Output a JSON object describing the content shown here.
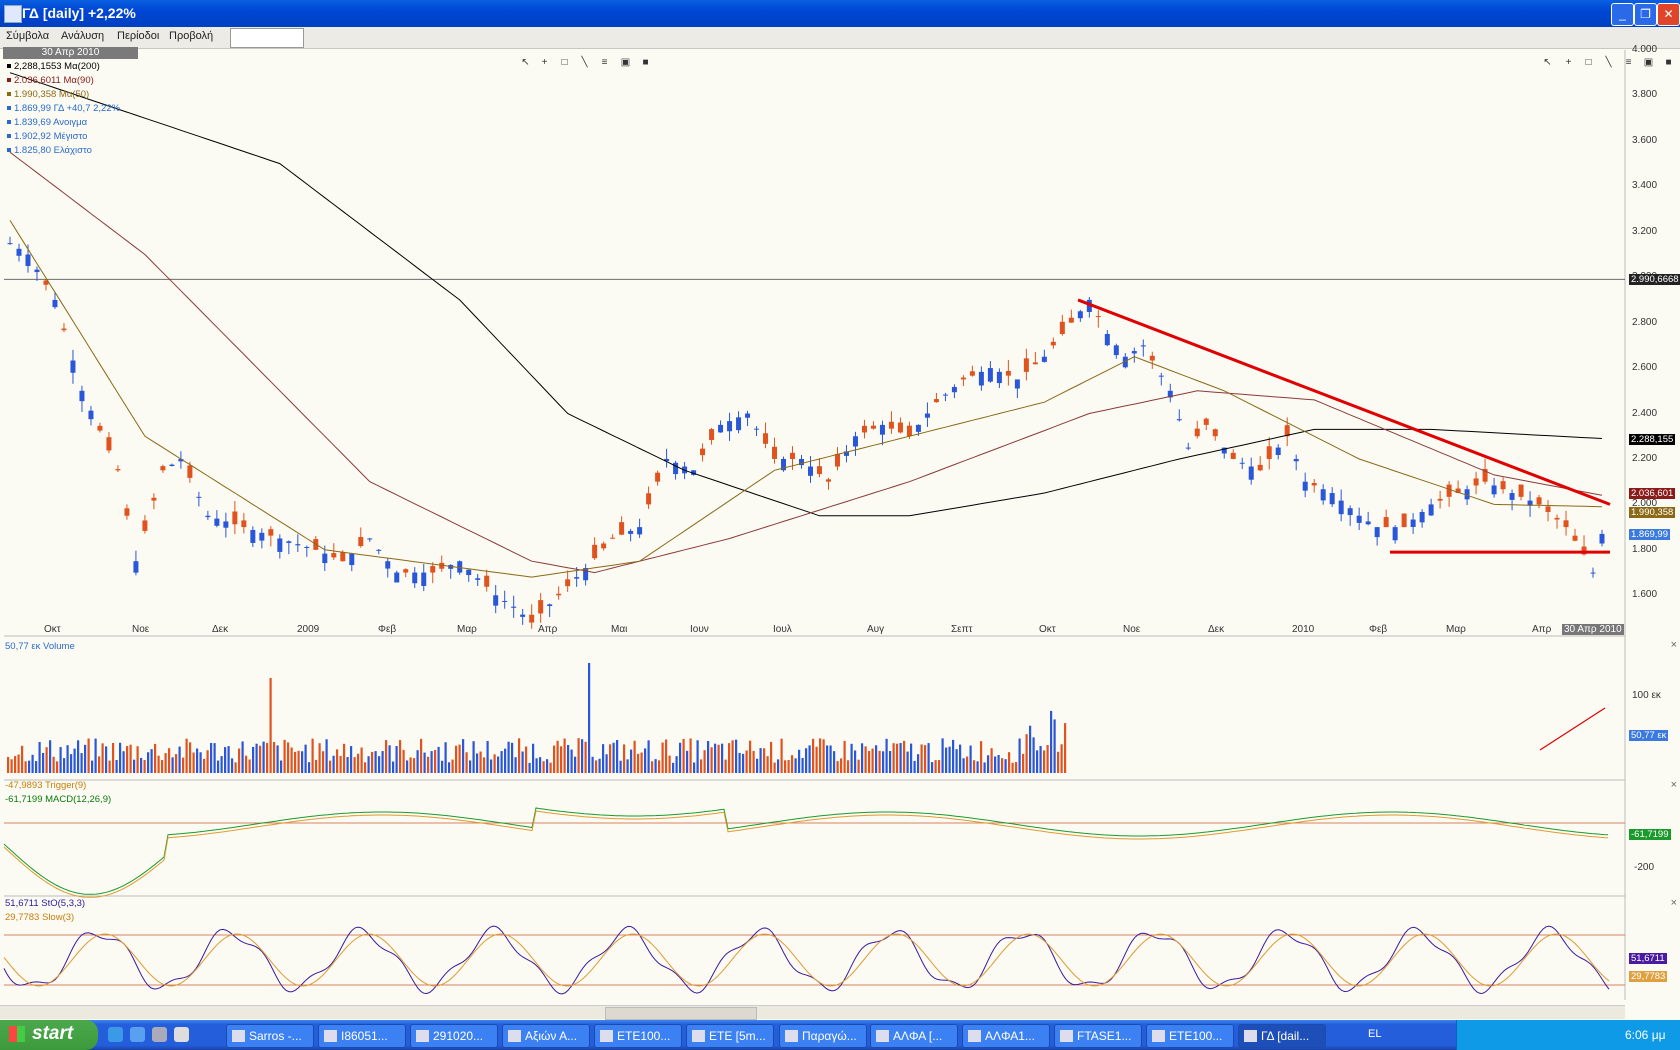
{
  "window": {
    "title": "ΓΔ [daily] +2,22%",
    "buttons": [
      "_",
      "❐",
      "✕"
    ]
  },
  "menu": [
    "Σύμβολα",
    "Ανάλυση",
    "Περίοδοι",
    "Προβολή"
  ],
  "symbol_input": {
    "value": ""
  },
  "date_tag": "30 Απρ 2010",
  "price_legend": [
    {
      "text": "2,288,1553 Mα(200)",
      "color": "#000000"
    },
    {
      "text": "2.036,6011 Mα(90)",
      "color": "#8b1a1a"
    },
    {
      "text": "1.990,358 Mα(50)",
      "color": "#8b6914"
    },
    {
      "text": "1.869,99 ΓΔ +40,7 2,22%",
      "color": "#2a6acc"
    },
    {
      "text": "1.839,69 Ανοιγμα",
      "color": "#2a6acc"
    },
    {
      "text": "1.902,92 Μέγιστο",
      "color": "#2a6acc"
    },
    {
      "text": "1.825,80 Ελάχιστο",
      "color": "#2a6acc"
    }
  ],
  "y_ticks": [
    "4.000",
    "3.800",
    "3.600",
    "3.400",
    "3.200",
    "3.000",
    "2.800",
    "2.600",
    "2.400",
    "2.200",
    "2.000",
    "1.800",
    "1.600"
  ],
  "x_ticks": [
    "Οκτ",
    "Νοε",
    "Δεκ",
    "2009",
    "Φεβ",
    "Μαρ",
    "Απρ",
    "Μαι",
    "Ιουν",
    "Ιουλ",
    "Αυγ",
    "Σεπτ",
    "Οκτ",
    "Νοε",
    "Δεκ",
    "2010",
    "Φεβ",
    "Μαρ",
    "Απρ"
  ],
  "x_last_tag": "30 Απρ 2010",
  "price_tags": [
    {
      "text": "2.990,6668",
      "bg": "#222222"
    },
    {
      "text": "2.288,155",
      "bg": "#000000"
    },
    {
      "text": "2.036,601",
      "bg": "#8b1a1a"
    },
    {
      "text": "1.990,358",
      "bg": "#8b6914"
    },
    {
      "text": "1.869,99",
      "bg": "#3a7ae0"
    }
  ],
  "volume": {
    "label": "50,77 εκ Volume",
    "tick": "100 εκ",
    "tag": "50,77 εκ"
  },
  "macd": {
    "labels": [
      "-47,9893 Trigger(9)",
      "-61,7199 MACD(12,26,9)"
    ],
    "tick": "-200",
    "tag": "-61,7199"
  },
  "stoch": {
    "labels": [
      "51,6711 StO(5,3,3)",
      "29,7783 Slow(3)"
    ],
    "tags": [
      "51,6711",
      "29,7783"
    ]
  },
  "colors": {
    "up": "#2a56d8",
    "down": "#e0531e",
    "ma200": "#000000",
    "ma90": "#8b3a3a",
    "ma50": "#8b6914",
    "trend": "#e00000"
  },
  "chart_data": {
    "type": "candlestick",
    "title": "ΓΔ [daily] +2,22%",
    "ylim": [
      1500,
      4000
    ],
    "last": {
      "close": 1869.99,
      "open": 1839.69,
      "high": 1902.92,
      "low": 1825.8,
      "change": 40.7,
      "change_pct": 2.22
    },
    "close_path": [
      [
        0,
        3150
      ],
      [
        2,
        3100
      ],
      [
        5,
        2900
      ],
      [
        8,
        2500
      ],
      [
        12,
        2150
      ],
      [
        14,
        1750
      ],
      [
        17,
        2150
      ],
      [
        19,
        2200
      ],
      [
        22,
        1950
      ],
      [
        26,
        1900
      ],
      [
        30,
        1850
      ],
      [
        34,
        1800
      ],
      [
        37,
        1750
      ],
      [
        40,
        1850
      ],
      [
        43,
        1700
      ],
      [
        47,
        1700
      ],
      [
        50,
        1750
      ],
      [
        54,
        1600
      ],
      [
        56,
        1550
      ],
      [
        58,
        1480
      ],
      [
        61,
        1600
      ],
      [
        64,
        1720
      ],
      [
        67,
        1850
      ],
      [
        70,
        1900
      ],
      [
        73,
        2200
      ],
      [
        76,
        2150
      ],
      [
        79,
        2350
      ],
      [
        82,
        2400
      ],
      [
        85,
        2200
      ],
      [
        88,
        2200
      ],
      [
        91,
        2100
      ],
      [
        94,
        2300
      ],
      [
        97,
        2350
      ],
      [
        100,
        2300
      ],
      [
        103,
        2450
      ],
      [
        106,
        2550
      ],
      [
        109,
        2600
      ],
      [
        112,
        2550
      ],
      [
        115,
        2650
      ],
      [
        118,
        2800
      ],
      [
        120,
        2900
      ],
      [
        122,
        2750
      ],
      [
        124,
        2650
      ],
      [
        126,
        2700
      ],
      [
        129,
        2500
      ],
      [
        131,
        2250
      ],
      [
        133,
        2350
      ],
      [
        136,
        2200
      ],
      [
        139,
        2150
      ],
      [
        142,
        2300
      ],
      [
        144,
        2100
      ],
      [
        147,
        2050
      ],
      [
        150,
        1950
      ],
      [
        152,
        1900
      ],
      [
        155,
        1900
      ],
      [
        158,
        2000
      ],
      [
        161,
        2050
      ],
      [
        164,
        2100
      ],
      [
        167,
        2050
      ],
      [
        170,
        2000
      ],
      [
        173,
        1900
      ],
      [
        175,
        1780
      ],
      [
        176,
        1700
      ],
      [
        177,
        1870
      ]
    ],
    "ma200": [
      [
        0,
        3900
      ],
      [
        30,
        3500
      ],
      [
        50,
        2900
      ],
      [
        62,
        2400
      ],
      [
        75,
        2150
      ],
      [
        90,
        1950
      ],
      [
        100,
        1950
      ],
      [
        115,
        2050
      ],
      [
        130,
        2200
      ],
      [
        145,
        2330
      ],
      [
        158,
        2330
      ],
      [
        177,
        2290
      ]
    ],
    "ma90": [
      [
        0,
        3550
      ],
      [
        15,
        3100
      ],
      [
        40,
        2100
      ],
      [
        58,
        1750
      ],
      [
        65,
        1700
      ],
      [
        80,
        1850
      ],
      [
        100,
        2100
      ],
      [
        120,
        2400
      ],
      [
        132,
        2500
      ],
      [
        145,
        2460
      ],
      [
        165,
        2130
      ],
      [
        177,
        2040
      ]
    ],
    "ma50": [
      [
        0,
        3250
      ],
      [
        15,
        2300
      ],
      [
        35,
        1800
      ],
      [
        58,
        1680
      ],
      [
        70,
        1750
      ],
      [
        85,
        2150
      ],
      [
        100,
        2300
      ],
      [
        115,
        2450
      ],
      [
        125,
        2650
      ],
      [
        135,
        2500
      ],
      [
        150,
        2200
      ],
      [
        165,
        2000
      ],
      [
        177,
        1990
      ]
    ],
    "trendlines": [
      {
        "from": [
          "Οκτ 2009",
          2900
        ],
        "to": [
          "30 Απρ 2010",
          2000
        ]
      },
      {
        "from": [
          "Φεβ 2010",
          1790
        ],
        "to": [
          "30 Απρ 2010",
          1790
        ]
      }
    ],
    "hline": 2990.6668
  }
}
